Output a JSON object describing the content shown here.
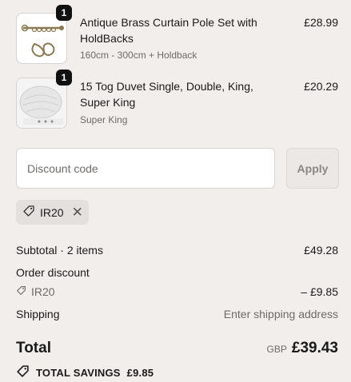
{
  "items": [
    {
      "quantity": "1",
      "title": "Antique Brass Curtain Pole Set with HoldBacks",
      "variant": "160cm - 300cm + Holdback",
      "price": "£28.99",
      "image_icon": "curtain-pole-image"
    },
    {
      "quantity": "1",
      "title": "15 Tog Duvet Single, Double, King, Super King",
      "variant": "Super King",
      "price": "£20.29",
      "image_icon": "duvet-image"
    }
  ],
  "discount": {
    "placeholder": "Discount code",
    "apply_label": "Apply",
    "applied_code": "IR20"
  },
  "summary": {
    "subtotal_label": "Subtotal · 2 items",
    "subtotal_value": "£49.28",
    "order_discount_label": "Order discount",
    "discount_code": "IR20",
    "discount_value": "– £9.85",
    "shipping_label": "Shipping",
    "shipping_value": "Enter shipping address",
    "total_label": "Total",
    "currency": "GBP",
    "total_value": "£39.43",
    "savings_label": "TOTAL SAVINGS",
    "savings_value": "£9.85"
  },
  "colors": {
    "background": "#f1eeec",
    "badge": "#111111"
  }
}
